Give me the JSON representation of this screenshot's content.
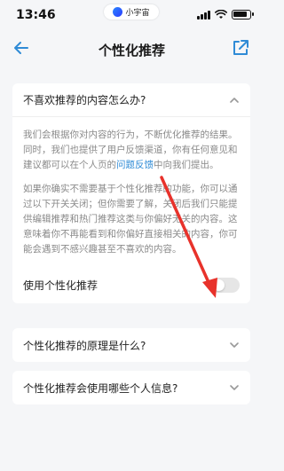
{
  "status_bar": {
    "time": "13:46",
    "app_pill_label": "小宇宙"
  },
  "nav": {
    "title": "个性化推荐"
  },
  "sections": [
    {
      "question": "不喜欢推荐的内容怎么办?",
      "expanded": true,
      "paragraph1_part1": "我们会根据你对内容的行为，不断优化推荐的结果。同时，我们也提供了用户反馈渠道，你有任何意见和建议都可以在个人页的",
      "paragraph1_link": "问题反馈",
      "paragraph1_part2": "中向我们提出。",
      "paragraph2": "如果你确实不需要基于个性化推荐的功能，你可以通过以下开关关闭；但你需要了解，关闭后我们只能提供编辑推荐和热门推荐这类与你偏好无关的内容。这意味着你不再能看到和你偏好直接相关的内容，你可能会遇到不感兴趣甚至不喜欢的内容。",
      "toggle_label": "使用个性化推荐",
      "toggle_on": false
    },
    {
      "question": "个性化推荐的原理是什么?",
      "expanded": false
    },
    {
      "question": "个性化推荐会使用哪些个人信息?",
      "expanded": false
    }
  ],
  "colors": {
    "accent": "#2f8bd6",
    "annotation_arrow": "#e8322b",
    "background": "#f5f6f8"
  },
  "icons": {
    "back": "arrow-left-icon",
    "share": "share-external-icon",
    "chevron_up": "chevron-up-icon",
    "chevron_down": "chevron-down-icon"
  }
}
